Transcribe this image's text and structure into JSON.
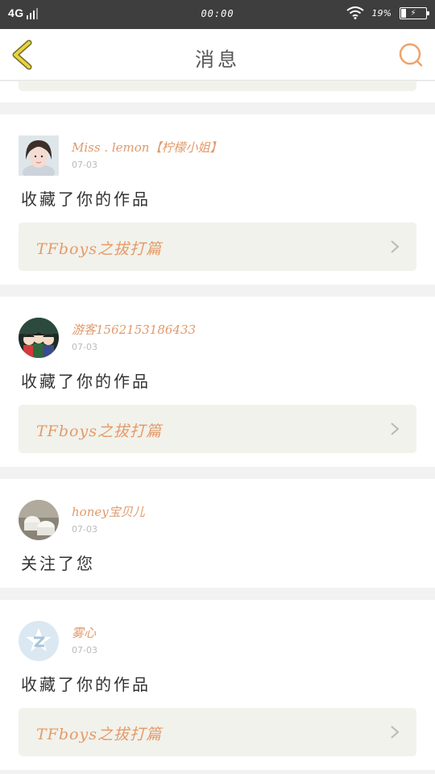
{
  "status_bar": {
    "network": "4G",
    "time": "00:00",
    "battery": "19%"
  },
  "header": {
    "title": "消息"
  },
  "messages": [
    {
      "username": "Miss . lemon【柠檬小姐】",
      "date": "07-03",
      "action": "收藏了你的作品",
      "work_title": "TFboys之拔打篇"
    },
    {
      "username": "游客1562153186433",
      "date": "07-03",
      "action": "收藏了你的作品",
      "work_title": "TFboys之拔打篇"
    },
    {
      "username": "honey宝贝儿",
      "date": "07-03",
      "action": "关注了您"
    },
    {
      "username": "雾心",
      "date": "07-03",
      "action": "收藏了你的作品",
      "work_title": "TFboys之拔打篇"
    }
  ],
  "colors": {
    "accent": "#e09a6c",
    "back_icon": "#e6c93a",
    "work_box": "#f1f2eb"
  },
  "icons": [
    "back-arrow-icon",
    "search-icon",
    "chevron-right-icon",
    "wifi-icon",
    "battery-icon",
    "signal-icon"
  ]
}
